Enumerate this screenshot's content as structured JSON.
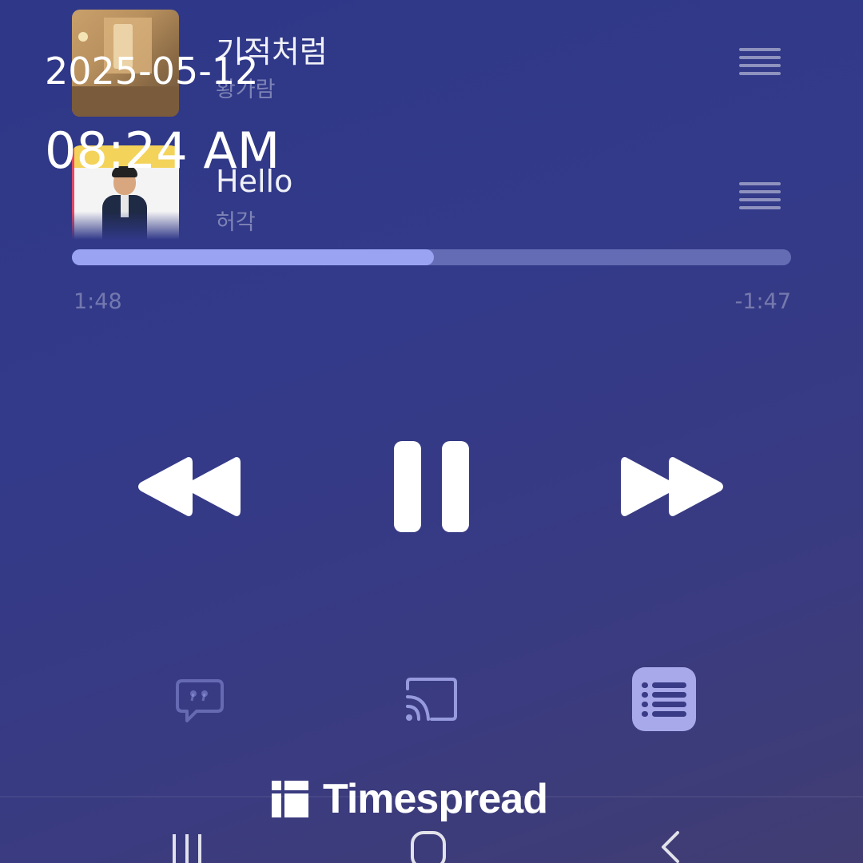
{
  "overlay": {
    "date": "2025-05-12",
    "time": "08:24 AM"
  },
  "queue": [
    {
      "title": "기적처럼",
      "artist": "황가람",
      "art": "album-art-warm-room"
    },
    {
      "title": "Hello",
      "artist": "허각",
      "art": "album-art-man-in-suit"
    }
  ],
  "progress": {
    "elapsed": "1:48",
    "remaining": "-1:47",
    "fraction": 0.503
  },
  "controls": {
    "previous_icon": "rewind-icon",
    "play_pause_icon": "pause-icon",
    "next_icon": "fast-forward-icon"
  },
  "bottom_actions": {
    "lyrics_icon": "lyrics-bubble-icon",
    "cast_icon": "cast-icon",
    "queue_icon": "queue-list-icon"
  },
  "watermark": {
    "text": "Timespread"
  },
  "navigation": {
    "recents_icon": "recents-icon",
    "home_icon": "home-icon",
    "back_icon": "back-icon"
  },
  "colors": {
    "background": "#333a89",
    "progress_fill": "#9aa3f2",
    "queue_button": "#a7a9ea"
  }
}
